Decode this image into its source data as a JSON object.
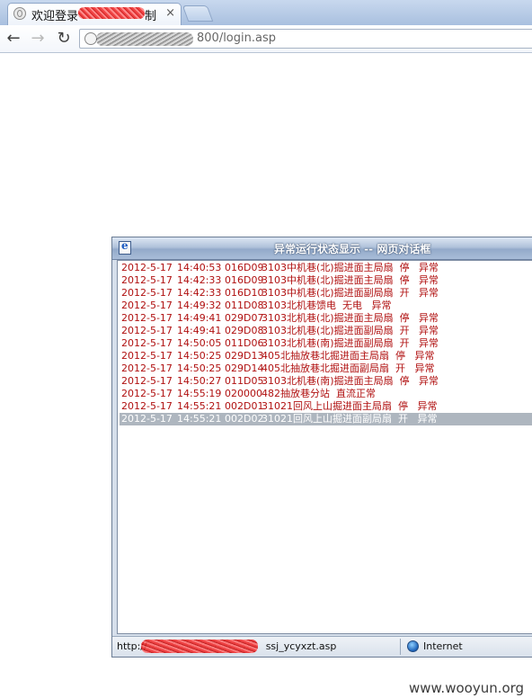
{
  "browser": {
    "tab": {
      "title": "欢迎登录",
      "title_suffix": "制系统",
      "close_glyph": "×"
    },
    "nav": {
      "back": "←",
      "forward": "→",
      "reload": "↻"
    },
    "address": {
      "url": "800/login.asp"
    }
  },
  "dialog": {
    "title": "异常运行状态显示 -- 网页对话框",
    "rows": [
      {
        "date": "2012-5-17",
        "time": "14:40:53",
        "code": "016D09",
        "text": "3103中机巷(北)掘进面主局扇  停   异常"
      },
      {
        "date": "2012-5-17",
        "time": "14:42:33",
        "code": "016D09",
        "text": "3103中机巷(北)掘进面主局扇  停   异常"
      },
      {
        "date": "2012-5-17",
        "time": "14:42:33",
        "code": "016D10",
        "text": "3103中机巷(北)掘进面副局扇  开   异常"
      },
      {
        "date": "2012-5-17",
        "time": "14:49:32",
        "code": "011D08",
        "text": "3103北机巷馈电  无电   异常"
      },
      {
        "date": "2012-5-17",
        "time": "14:49:41",
        "code": "029D07",
        "text": "3103北机巷(北)掘进面主局扇  停   异常"
      },
      {
        "date": "2012-5-17",
        "time": "14:49:41",
        "code": "029D08",
        "text": "3103北机巷(北)掘进面副局扇  开   异常"
      },
      {
        "date": "2012-5-17",
        "time": "14:50:05",
        "code": "011D06",
        "text": "3103北机巷(南)掘进面副局扇  开   异常"
      },
      {
        "date": "2012-5-17",
        "time": "14:50:25",
        "code": "029D13",
        "text": "405北抽放巷北掘进面主局扇  停   异常"
      },
      {
        "date": "2012-5-17",
        "time": "14:50:25",
        "code": "029D14",
        "text": "405北抽放巷北掘进面副局扇  开   异常"
      },
      {
        "date": "2012-5-17",
        "time": "14:50:27",
        "code": "011D05",
        "text": "3103北机巷(南)掘进面主局扇  停   异常"
      },
      {
        "date": "2012-5-17",
        "time": "14:55:19",
        "code": "020000",
        "text": "482抽放巷分站  直流正常"
      },
      {
        "date": "2012-5-17",
        "time": "14:55:21",
        "code": "002D01",
        "text": "31021回风上山掘进面主局扇  停   异常"
      },
      {
        "date": "2012-5-17",
        "time": "14:55:21",
        "code": "002D02",
        "text": "31021回风上山掘进面副局扇  开   异常",
        "selected": true
      }
    ],
    "status": {
      "url_prefix": "http://",
      "url_suffix": "ssj_ycyxzt.asp",
      "zone": "Internet"
    }
  },
  "watermark": "www.wooyun.org"
}
